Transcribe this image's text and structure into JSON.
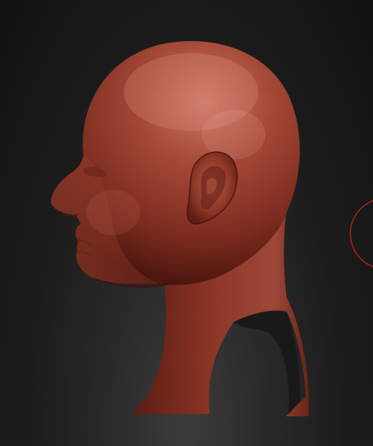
{
  "viewport": {
    "background_color": "#141414",
    "mesh_color": "#8e3426",
    "mesh_highlight": "#c8725f",
    "gizmo_color": "#b8231c"
  },
  "model": {
    "icon": "sculpt-head-mesh"
  }
}
